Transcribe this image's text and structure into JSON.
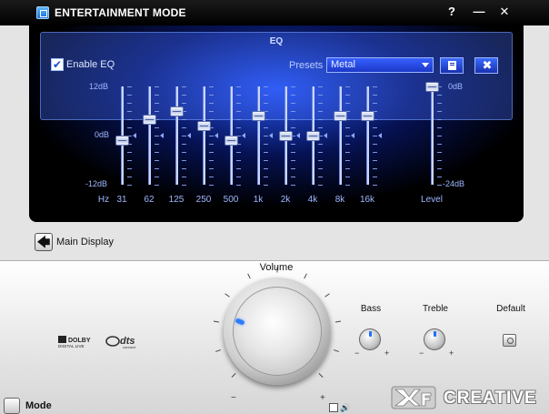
{
  "window": {
    "title": "ENTERTAINMENT MODE",
    "help_label": "?",
    "minimize_label": "—",
    "close_label": "✕"
  },
  "eq": {
    "title": "EQ",
    "enable_label": "Enable EQ",
    "enabled": true,
    "check_mark": "✔",
    "presets_label": "Presets",
    "preset_value": "Metal",
    "delete_glyph": "✖",
    "db_top": "12dB",
    "db_mid": "0dB",
    "db_bottom": "-12dB",
    "hz_label": "Hz",
    "bands": [
      {
        "label": "31",
        "gain_db": -1
      },
      {
        "label": "62",
        "gain_db": 4
      },
      {
        "label": "125",
        "gain_db": 6
      },
      {
        "label": "250",
        "gain_db": 2.5
      },
      {
        "label": "500",
        "gain_db": -1
      },
      {
        "label": "1k",
        "gain_db": 5
      },
      {
        "label": "2k",
        "gain_db": 0
      },
      {
        "label": "4k",
        "gain_db": 0
      },
      {
        "label": "8k",
        "gain_db": 5
      },
      {
        "label": "16k",
        "gain_db": 5
      }
    ],
    "level": {
      "label": "Level",
      "top_label": "0dB",
      "bottom_label": "-24dB",
      "value_db": 0
    }
  },
  "nav": {
    "main_display_label": "Main Display",
    "back_glyph": "🡄"
  },
  "controls": {
    "volume_label": "Volume",
    "bass_label": "Bass",
    "treble_label": "Treble",
    "default_label": "Default",
    "minus": "−",
    "plus": "+",
    "volume_value": 0.25
  },
  "footer": {
    "mode_label": "Mode",
    "brand": "CREATIVE",
    "dolby_line1": "DOLBY",
    "dolby_line2": "DIGITAL LIVE",
    "dts_line1": "dts",
    "dts_line2": "connect",
    "speaker_glyph": "🔊"
  },
  "colors": {
    "panel_blue": "#2850ff",
    "accent": "#2d7cff"
  }
}
